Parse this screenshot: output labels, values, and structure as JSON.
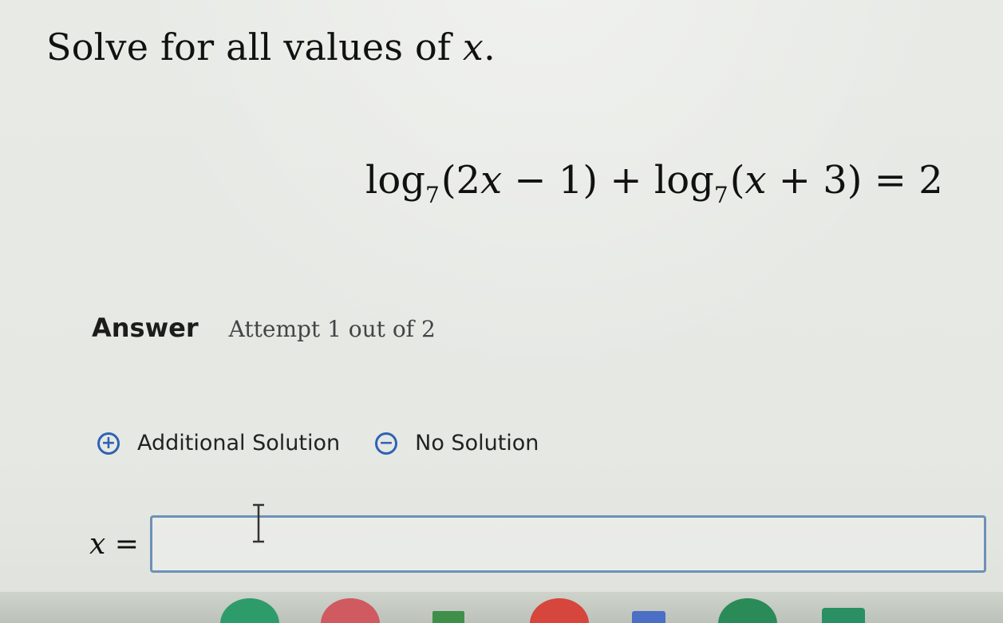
{
  "question": {
    "prefix": "Solve for all values of ",
    "variable": "x",
    "suffix": "."
  },
  "equation": {
    "log1": "log",
    "base1": "7",
    "arg1_open": "(2",
    "arg1_var": "x",
    "arg1_rest": " − 1)",
    "plus": " + ",
    "log2": "log",
    "base2": "7",
    "arg2_open": "(",
    "arg2_var": "x",
    "arg2_rest": " + 3)",
    "equals": " = 2"
  },
  "answer": {
    "label": "Answer",
    "attempt": "Attempt 1 out of 2"
  },
  "options": {
    "additional_label": "Additional Solution",
    "additional_icon": "+",
    "no_solution_label": "No Solution",
    "no_solution_icon": "−"
  },
  "input": {
    "lhs_var": "x",
    "lhs_eq": " =",
    "value": ""
  },
  "colors": {
    "accent": "#2f63b4",
    "input_border": "#6d90b8"
  }
}
